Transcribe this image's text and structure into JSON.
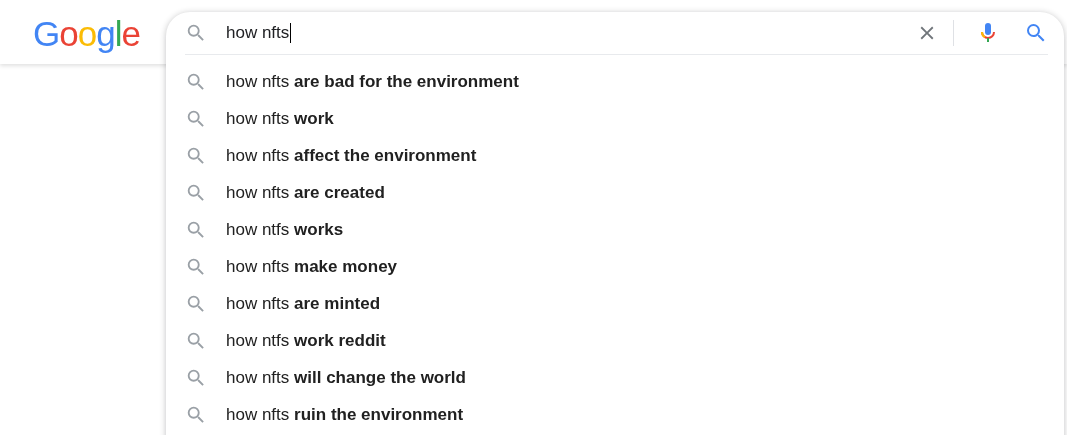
{
  "logo": "Google",
  "search": {
    "value": "how nfts"
  },
  "suggestions": [
    "how nfts **are bad for the environment**",
    "how nfts **work**",
    "how nfts **affect the environment**",
    "how nfts **are created**",
    "how ntfs **works**",
    "how nfts **make money**",
    "how nfts **are minted**",
    "how ntfs **work reddit**",
    "how nfts **will change the world**",
    "how nfts **ruin the environment**"
  ]
}
